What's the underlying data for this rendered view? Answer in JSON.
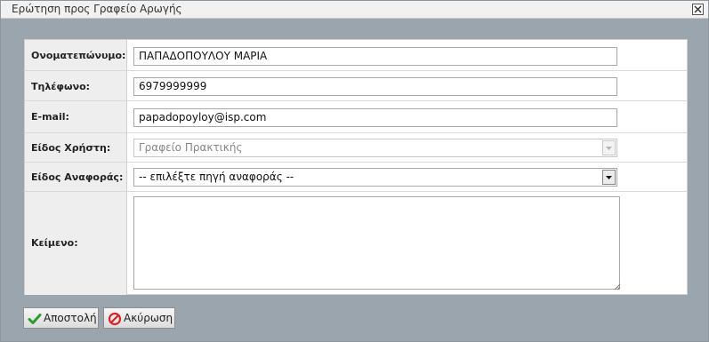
{
  "window": {
    "title": "Ερώτηση προς Γραφείο Αρωγής"
  },
  "form": {
    "fullname": {
      "label": "Ονοματεπώνυμο:",
      "value": "ΠΑΠΑΔΟΠΟΥΛΟΥ ΜΑΡΙΑ"
    },
    "phone": {
      "label": "Τηλέφωνο:",
      "value": "6979999999"
    },
    "email": {
      "label": "E-mail:",
      "value": "papadopoyloy@isp.com"
    },
    "user_type": {
      "label": "Είδος Χρήστη:",
      "selected": "Γραφείο Πρακτικής",
      "disabled": true
    },
    "report_type": {
      "label": "Είδος Αναφοράς:",
      "selected": "-- επιλέξτε πηγή αναφοράς --"
    },
    "text": {
      "label": "Κείμενο:",
      "value": ""
    }
  },
  "buttons": {
    "submit": {
      "label": "Αποστολή",
      "icon": "checkmark-icon",
      "color": "#2e9b2e"
    },
    "cancel": {
      "label": "Ακύρωση",
      "icon": "cancel-icon",
      "color": "#d2242a"
    }
  },
  "colors": {
    "dialog_bg": "#9aa5ae",
    "label_bg": "#eeeeee"
  }
}
